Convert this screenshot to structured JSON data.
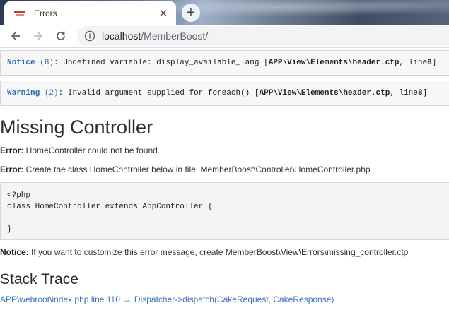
{
  "browser": {
    "tab_title": "Errors",
    "tab_close": "✕",
    "new_tab": "+",
    "url_host": "localhost",
    "url_path": "/MemberBoost/"
  },
  "errors": [
    {
      "level": "Notice",
      "code": "(8)",
      "message": ": Undefined variable: display_available_lang [",
      "file": "APP\\View\\Elements\\header.ctp",
      "line_text": ", line ",
      "line": "8",
      "close": "]"
    },
    {
      "level": "Warning",
      "code": "(2)",
      "message": ": Invalid argument supplied for foreach() [",
      "file": "APP\\View\\Elements\\header.ctp",
      "line_text": ", line ",
      "line": "8",
      "close": "]"
    }
  ],
  "page": {
    "title": "Missing Controller",
    "msg1_label": "Error:",
    "msg1_text": " HomeController could not be found.",
    "msg2_label": "Error:",
    "msg2_text": " Create the class HomeController below in file: MemberBoost\\Controller\\HomeController.php",
    "code": "<?php\nclass HomeController extends AppController {\n\n}",
    "msg3_label": "Notice:",
    "msg3_text": " If you want to customize this error message, create MemberBoost\\View\\Errors\\missing_controller.ctp",
    "stack_title": "Stack Trace",
    "trace_file": "APP\\webroot\\index.php line 110",
    "trace_arrow": "→",
    "trace_call": "Dispatcher->dispatch(CakeRequest, CakeResponse)"
  },
  "colors": {
    "link": "#3b73b9",
    "xdebug_label": "#2c6bb0"
  }
}
